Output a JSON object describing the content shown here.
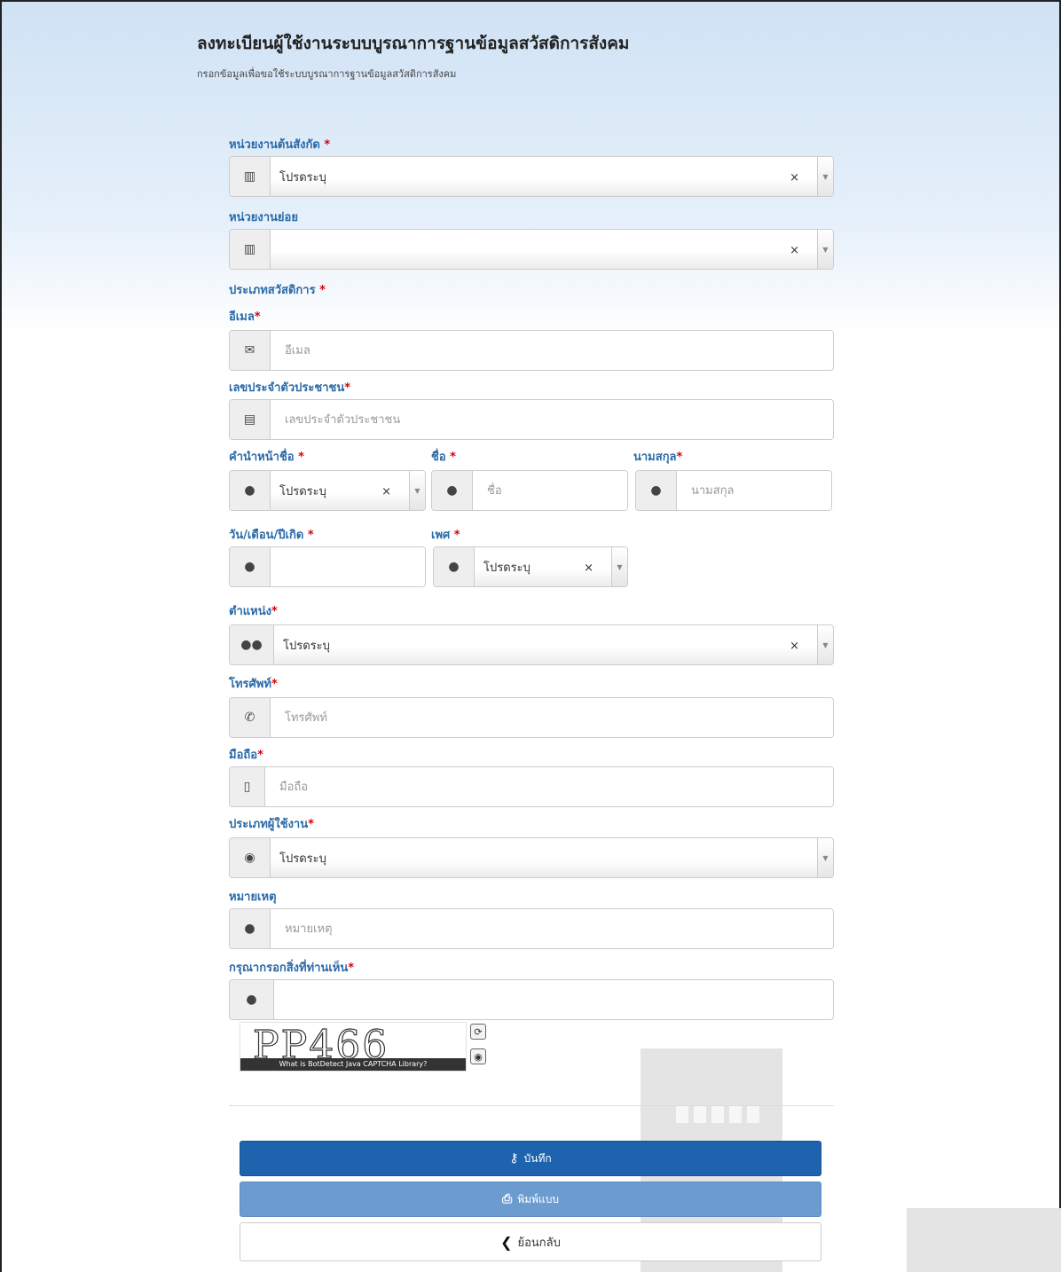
{
  "header": {
    "title": "ลงทะเบียนผู้ใช้งานระบบบูรณาการฐานข้อมูลสวัสดิการสังคม",
    "subtitle": "กรอกข้อมูลเพื่อขอใช้ระบบบูรณาการฐานข้อมูลสวัสดิการสังคม"
  },
  "fields": {
    "agency": {
      "label": "หน่วยงานต้นสังกัด",
      "req": "*",
      "value": "โปรดระบุ",
      "clear": "×",
      "caret": "▼"
    },
    "sub_agency": {
      "label": "หน่วยงานย่อย",
      "value": "",
      "clear": "×",
      "caret": "▼"
    },
    "welfare_type": {
      "label": "ประเภทสวัสดิการ",
      "req": "*"
    },
    "email": {
      "label": "อีเมล",
      "req": "*",
      "placeholder": "อีเมล"
    },
    "citizen_id": {
      "label": "เลขประจำตัวประชาชน",
      "req": "*",
      "placeholder": "เลขประจำตัวประชาชน"
    },
    "prefix": {
      "label": "คำนำหน้าชื่อ",
      "req": "*",
      "value": "โปรดระบุ",
      "clear": "×",
      "caret": "▼"
    },
    "first_name": {
      "label": "ชื่อ",
      "req": "*",
      "placeholder": "ชื่อ"
    },
    "last_name": {
      "label": "นามสกุล",
      "req": "*",
      "placeholder": "นามสกุล"
    },
    "birthdate": {
      "label": "วัน/เดือน/ปีเกิด",
      "req": "*",
      "value": ""
    },
    "gender": {
      "label": "เพศ",
      "req": "*",
      "value": "โปรดระบุ",
      "clear": "×",
      "caret": "▼"
    },
    "position": {
      "label": "ตำแหน่ง",
      "req": "*",
      "value": "โปรดระบุ",
      "clear": "×",
      "caret": "▼"
    },
    "phone": {
      "label": "โทรศัพท์",
      "req": "*",
      "placeholder": "โทรศัพท์"
    },
    "mobile": {
      "label": "มือถือ",
      "req": "*",
      "placeholder": "มือถือ"
    },
    "user_type": {
      "label": "ประเภทผู้ใช้งาน",
      "req": "*",
      "value": "โปรดระบุ",
      "caret": "▼"
    },
    "note": {
      "label": "หมายเหตุ",
      "placeholder": "หมายเหตุ"
    },
    "captcha_input": {
      "label": "กรุณากรอกสิ่งที่ท่านเห็น",
      "req": "*",
      "value": ""
    }
  },
  "captcha": {
    "text": "PP466",
    "caption": "What is BotDetect Java CAPTCHA Library?",
    "reload_icon": "⟳",
    "sound_icon": "◉"
  },
  "icons": {
    "building": "▥",
    "envelope": "✉",
    "id_card": "▤",
    "user": "●",
    "calendar": "▦",
    "users": "●●",
    "phone": "✆",
    "mobile": "▯",
    "user_circle": "◉",
    "comment": "●",
    "key": "⚷",
    "print": "⎙",
    "back": "❮"
  },
  "buttons": {
    "save": "บันทึก",
    "print": "พิมพ์แบบ",
    "back": "ย้อนกลับ"
  },
  "colors": {
    "label": "#2a6aa8",
    "required": "#d9000a",
    "save_button": "#1e63ad",
    "print_button": "#6c9ccf"
  }
}
